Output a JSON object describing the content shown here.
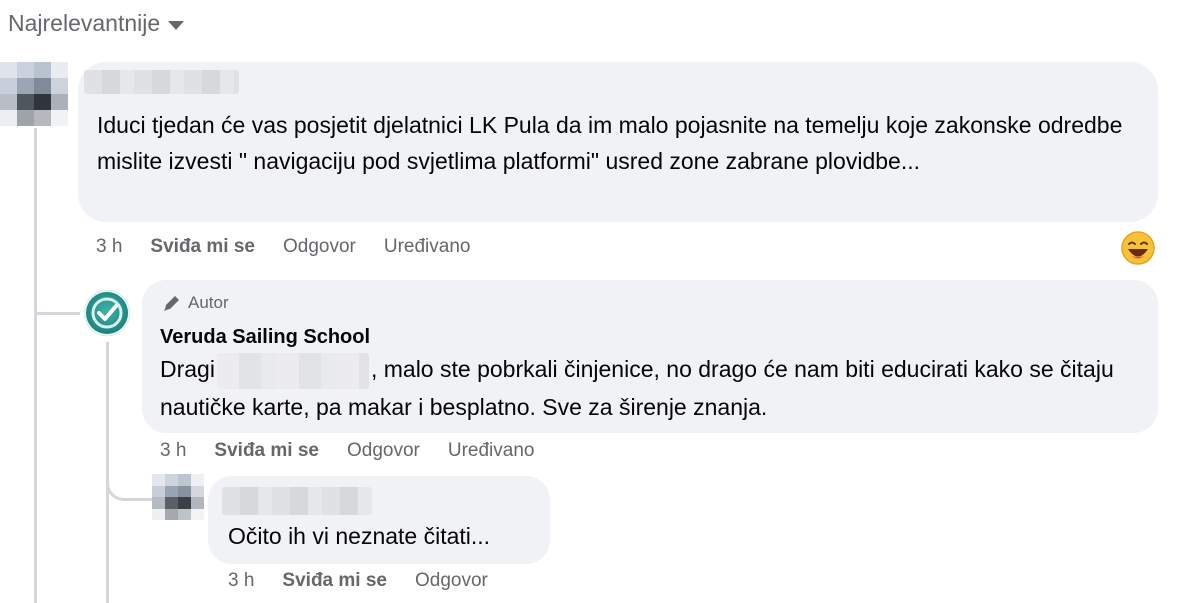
{
  "sort": {
    "label": "Najrelevantnije"
  },
  "comments": [
    {
      "text": "Iduci tjedan će vas posjetit djelatnici LK Pula da im malo pojasnite na temelju koje zakonske odredbe mislite izvesti \" navigaciju pod svjetlima platformi\" usred zone zabrane plovidbe...",
      "time": "3 h",
      "like": "Sviđa mi se",
      "reply": "Odgovor",
      "edited": "Uređivano",
      "reaction_icon": "laughing-emoji-icon"
    },
    {
      "author_badge": "Autor",
      "author": "Veruda Sailing School",
      "text_before": "Dragi",
      "text_after": ", malo ste pobrkali činjenice, no drago će nam biti educirati kako se čitaju nautičke karte, pa makar i besplatno. Sve za širenje znanja.",
      "time": "3 h",
      "like": "Sviđa mi se",
      "reply": "Odgovor",
      "edited": "Uređivano"
    },
    {
      "text": "Očito ih vi neznate čitati...",
      "time": "3 h",
      "like": "Sviđa mi se",
      "reply": "Odgovor"
    }
  ],
  "colors": {
    "bubble": "#f0f2f5",
    "secondary_text": "#65676b",
    "thread_line": "#d5d7db",
    "brand_teal": "#238b86"
  }
}
